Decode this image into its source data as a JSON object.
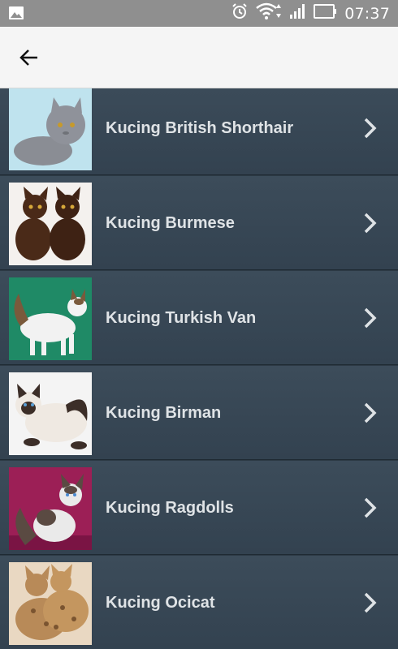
{
  "status_bar": {
    "time": "07:37",
    "icons": [
      "image-notification-icon",
      "alarm-icon",
      "wifi-icon",
      "signal-icon",
      "battery-icon"
    ]
  },
  "toolbar": {
    "back_icon": "arrow-left-icon"
  },
  "colors": {
    "toolbar_bg": "#f5f5f5",
    "status_bg": "#8f8f8f",
    "row_bg": "#3a4a58",
    "row_text": "#dfe3e6"
  },
  "cats": [
    {
      "name": "Kucing British Shorthair",
      "thumb_bg": "#bfe3ee",
      "cat": "#8a8d94",
      "accent": "#6f7278"
    },
    {
      "name": "Kucing Burmese",
      "thumb_bg": "#f4f1ee",
      "cat": "#4a2a18",
      "accent": "#2e1a0f"
    },
    {
      "name": "Kucing Turkish Van",
      "thumb_bg": "#1f8a66",
      "cat": "#f2f2f2",
      "accent": "#7a5a3c"
    },
    {
      "name": "Kucing Birman",
      "thumb_bg": "#f4f4f4",
      "cat": "#efe9e2",
      "accent": "#3c2e28"
    },
    {
      "name": "Kucing Ragdolls",
      "thumb_bg": "#9c1f56",
      "cat": "#eaeaea",
      "accent": "#5a4a42"
    },
    {
      "name": "Kucing Ocicat",
      "thumb_bg": "#e9d8c2",
      "cat": "#b88a58",
      "accent": "#7a5430"
    }
  ]
}
